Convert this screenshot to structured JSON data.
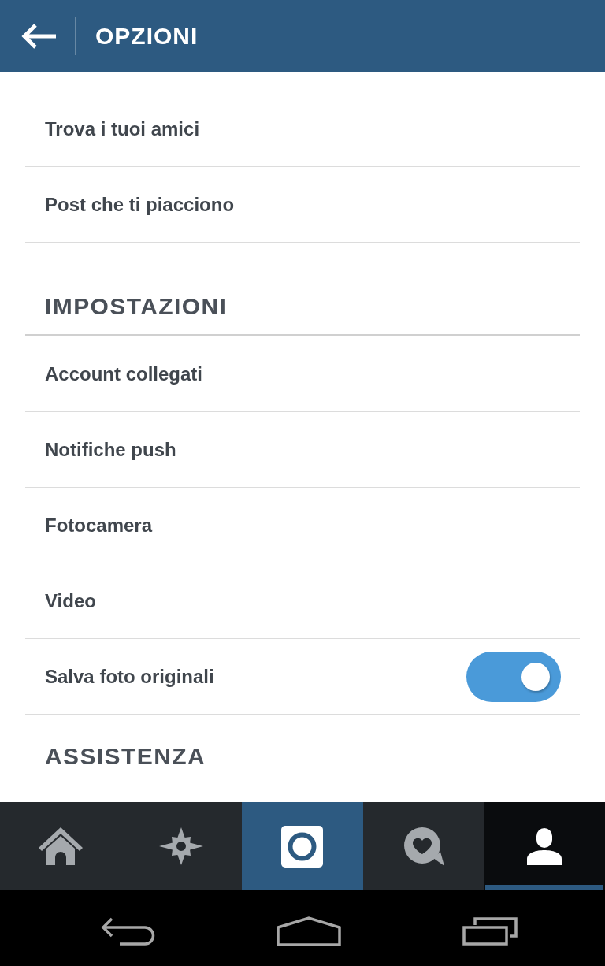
{
  "header": {
    "title": "OPZIONI"
  },
  "sections": [
    {
      "items": [
        {
          "label": "Trova i tuoi amici",
          "kind": "link"
        },
        {
          "label": "Post che ti piacciono",
          "kind": "link"
        }
      ]
    },
    {
      "title": "IMPOSTAZIONI",
      "items": [
        {
          "label": "Account collegati",
          "kind": "link"
        },
        {
          "label": "Notifiche push",
          "kind": "link"
        },
        {
          "label": "Fotocamera",
          "kind": "link"
        },
        {
          "label": "Video",
          "kind": "link"
        },
        {
          "label": "Salva foto originali",
          "kind": "toggle",
          "on": true
        }
      ]
    },
    {
      "title": "ASSISTENZA"
    }
  ],
  "tab_bar": {
    "tabs": [
      {
        "kind": "plain",
        "selected": false
      },
      {
        "kind": "plain",
        "selected": false
      },
      {
        "kind": "accent",
        "selected": false
      },
      {
        "kind": "plain",
        "selected": false
      },
      {
        "kind": "plain",
        "selected": true
      }
    ]
  }
}
